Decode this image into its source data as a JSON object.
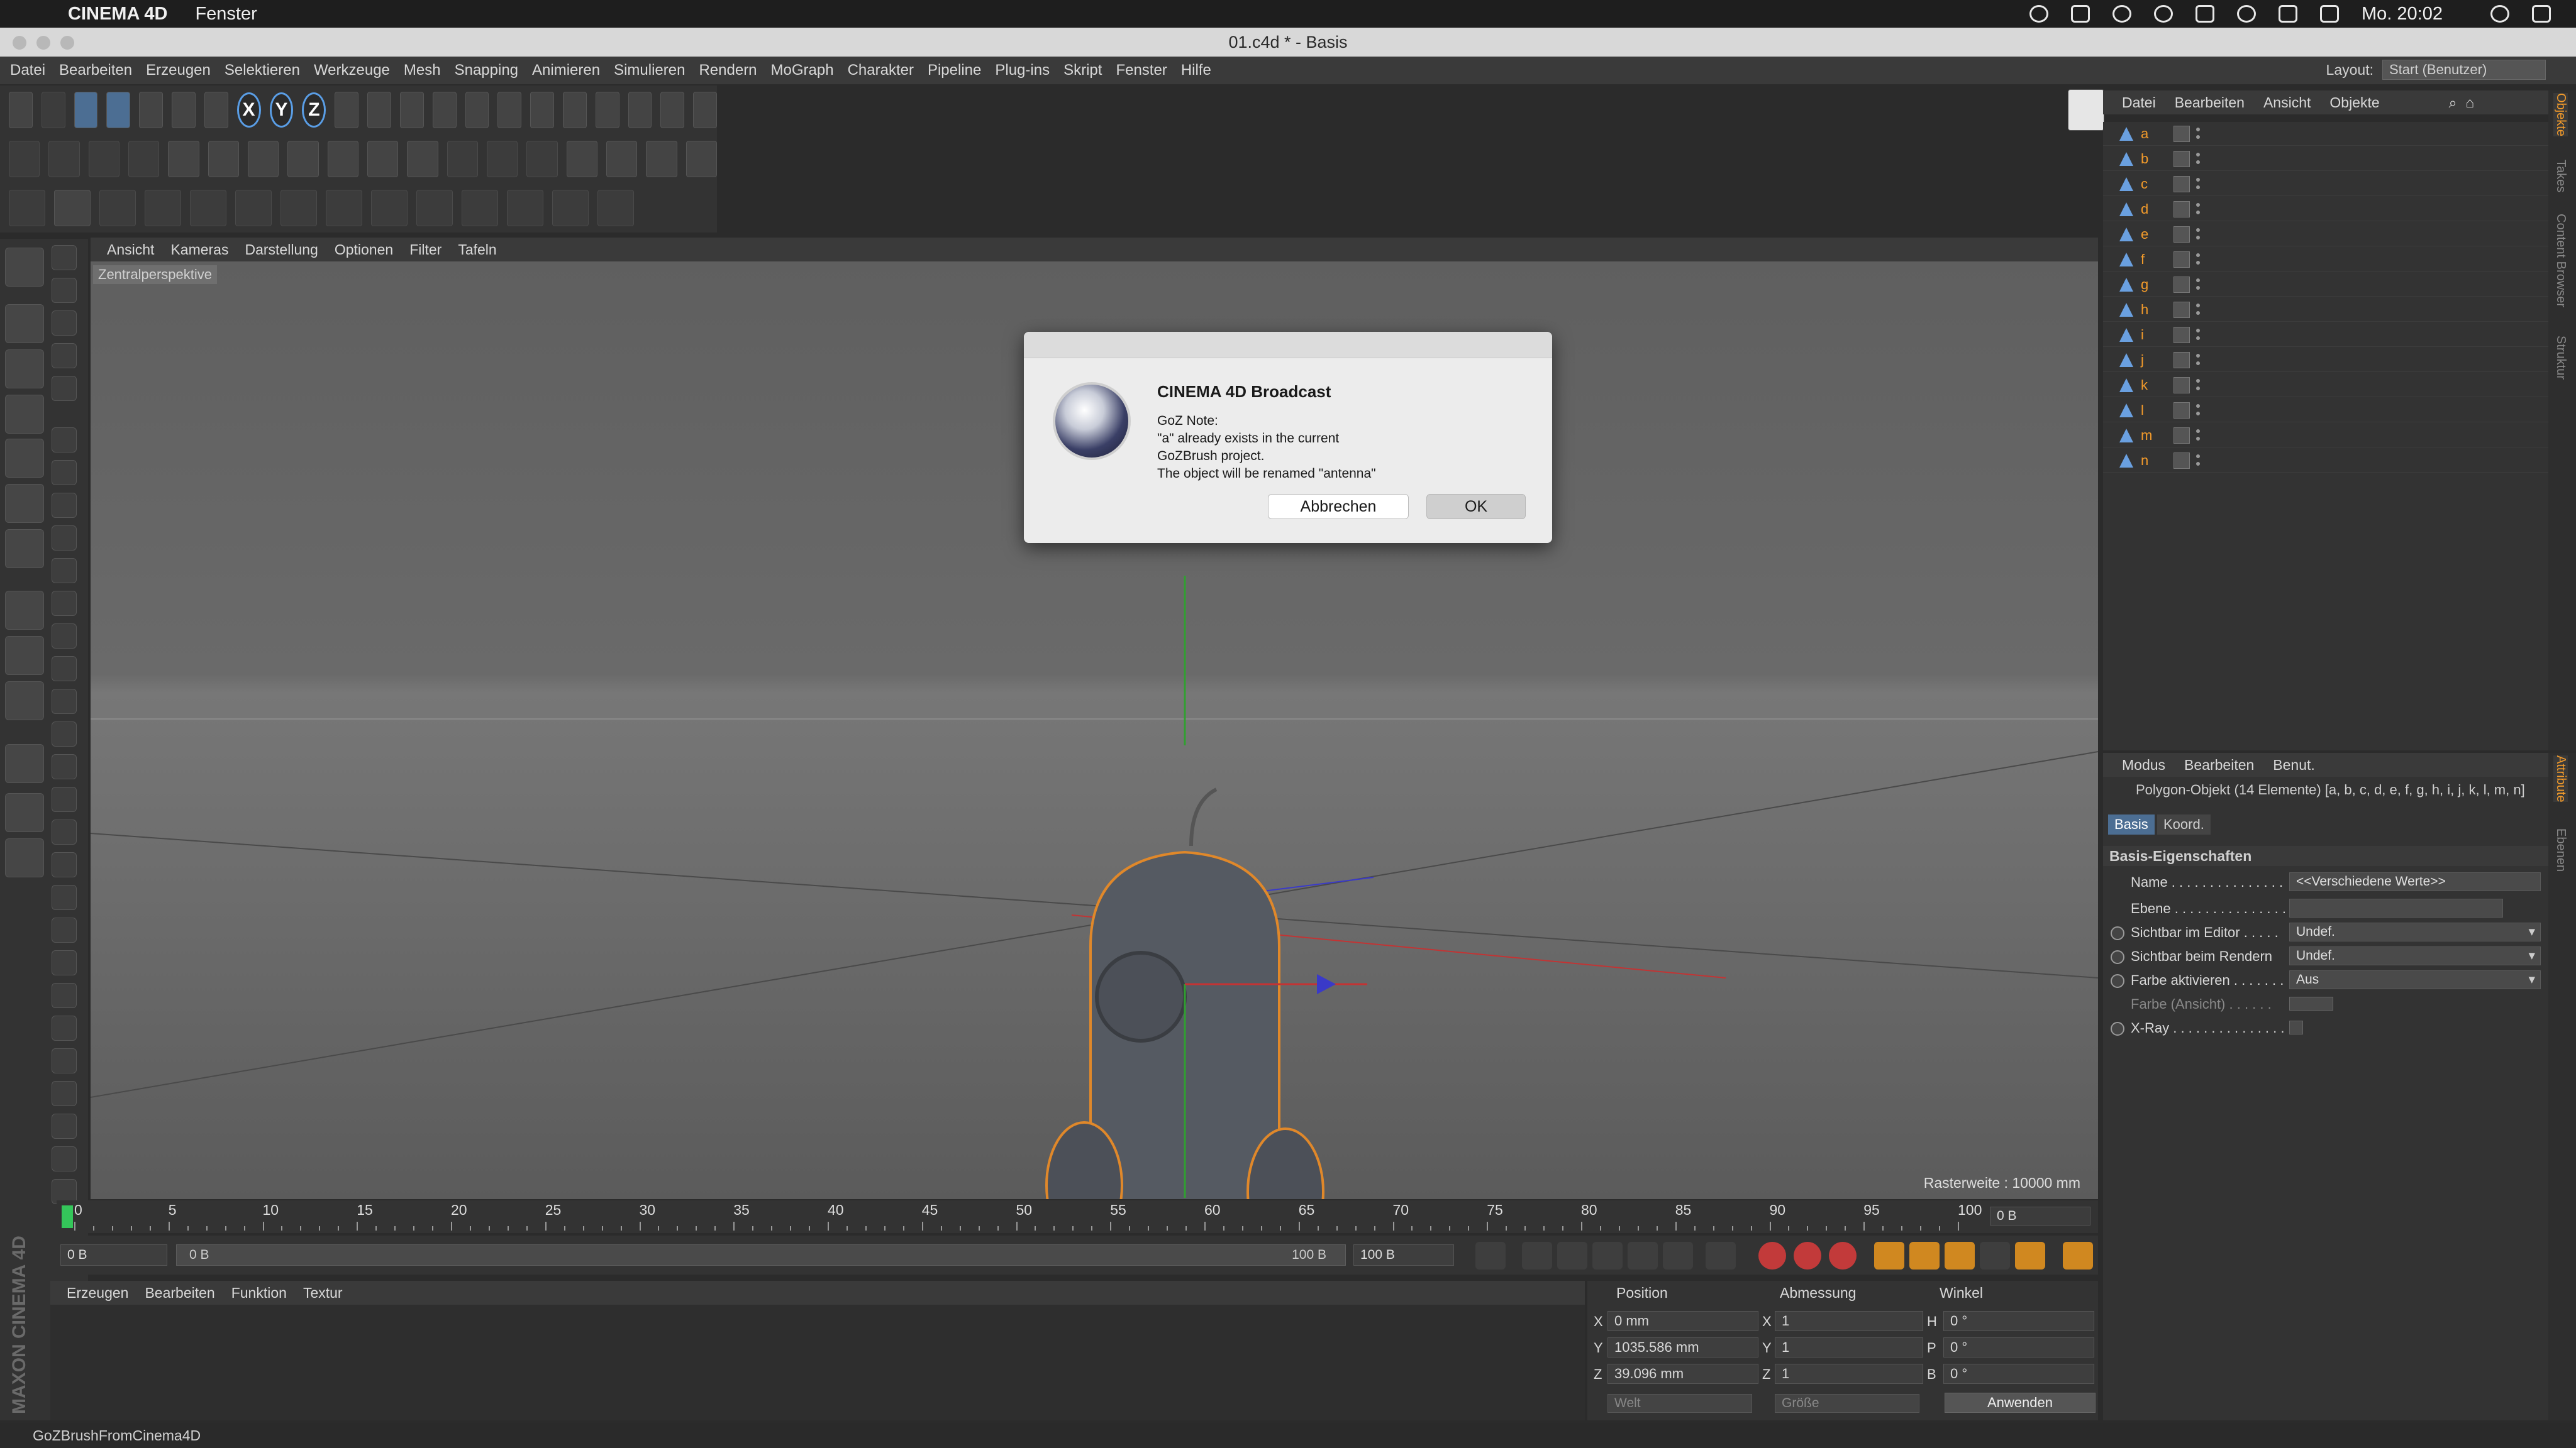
{
  "mac_menubar": {
    "app_name": "CINEMA 4D",
    "menu": "Fenster",
    "clock": "Mo. 20:02"
  },
  "window": {
    "title": "01.c4d * - Basis"
  },
  "c4d_menu": [
    "Datei",
    "Bearbeiten",
    "Erzeugen",
    "Selektieren",
    "Werkzeuge",
    "Mesh",
    "Snapping",
    "Animieren",
    "Simulieren",
    "Rendern",
    "MoGraph",
    "Charakter",
    "Pipeline",
    "Plug-ins",
    "Skript",
    "Fenster",
    "Hilfe"
  ],
  "layout": {
    "label": "Layout:",
    "value": "Start (Benutzer)"
  },
  "toolbar": {
    "axis_x": "X",
    "axis_y": "Y",
    "axis_z": "Z"
  },
  "viewport": {
    "menu": [
      "Ansicht",
      "Kameras",
      "Darstellung",
      "Optionen",
      "Filter",
      "Tafeln"
    ],
    "camera_label": "Zentralperspektive",
    "raster": "Rasterweite : 10000 mm"
  },
  "dialog": {
    "heading": "CINEMA 4D Broadcast",
    "lines": [
      "GoZ Note:",
      "\"a\" already exists in the current",
      "GoZBrush project.",
      "The object will be renamed \"antenna\""
    ],
    "cancel_label": "Abbrechen",
    "ok_label": "OK"
  },
  "timeline": {
    "ticks": [
      "0",
      "5",
      "10",
      "15",
      "20",
      "25",
      "30",
      "35",
      "40",
      "45",
      "50",
      "55",
      "60",
      "65",
      "70",
      "75",
      "80",
      "85",
      "90",
      "95",
      "100"
    ],
    "current_frame": "0 B"
  },
  "transport": {
    "start": "0 B",
    "range_start": "0 B",
    "range_end": "100 B",
    "end": "100 B"
  },
  "material_manager": {
    "menu": [
      "Erzeugen",
      "Bearbeiten",
      "Funktion",
      "Textur"
    ]
  },
  "maxon_logo": "MAXON CINEMA 4D",
  "coordinates": {
    "headers": [
      "Position",
      "Abmessung",
      "Winkel"
    ],
    "rows": [
      {
        "axis": "X",
        "position": "0 mm",
        "size_axis": "X",
        "size": "1",
        "angle_axis": "H",
        "angle": "0 °"
      },
      {
        "axis": "Y",
        "position": "1035.586 mm",
        "size_axis": "Y",
        "size": "1",
        "angle_axis": "P",
        "angle": "0 °"
      },
      {
        "axis": "Z",
        "position": "39.096 mm",
        "size_axis": "Z",
        "size": "1",
        "angle_axis": "B",
        "angle": "0 °"
      }
    ],
    "mode_world": "Welt",
    "mode_size": "Größe",
    "apply_label": "Anwenden"
  },
  "statusbar": "GoZBrushFromCinema4D",
  "object_manager": {
    "menu": [
      "Datei",
      "Bearbeiten",
      "Ansicht",
      "Objekte"
    ],
    "objects": [
      "a",
      "b",
      "c",
      "d",
      "e",
      "f",
      "g",
      "h",
      "i",
      "j",
      "k",
      "l",
      "m",
      "n"
    ]
  },
  "side_tabs": [
    "Objekte",
    "Takes",
    "Content Browser",
    "Struktur"
  ],
  "side_tabs_bottom": [
    "Attribute",
    "Ebenen"
  ],
  "attribute_manager": {
    "menu": [
      "Modus",
      "Bearbeiten",
      "Benut."
    ],
    "object_line": "Polygon-Objekt (14 Elemente) [a, b, c, d, e, f, g, h, i, j, k, l, m, n]",
    "tabs": [
      "Basis",
      "Koord."
    ],
    "section": "Basis-Eigenschaften",
    "rows": [
      {
        "label": "Name . . . . . . . . . . . . . . .",
        "value": "<<Verschiedene Werte>>"
      },
      {
        "label": "Ebene . . . . . . . . . . . . . . .",
        "value": ""
      },
      {
        "label": "Sichtbar im Editor . . . . .",
        "value": "Undef."
      },
      {
        "label": "Sichtbar beim Rendern",
        "value": "Undef."
      },
      {
        "label": "Farbe aktivieren . . . . . . .",
        "value": "Aus"
      },
      {
        "label": "Farbe (Ansicht) . . . . . .",
        "value": ""
      },
      {
        "label": "X-Ray . . . . . . . . . . . . . . .",
        "value": ""
      }
    ]
  }
}
